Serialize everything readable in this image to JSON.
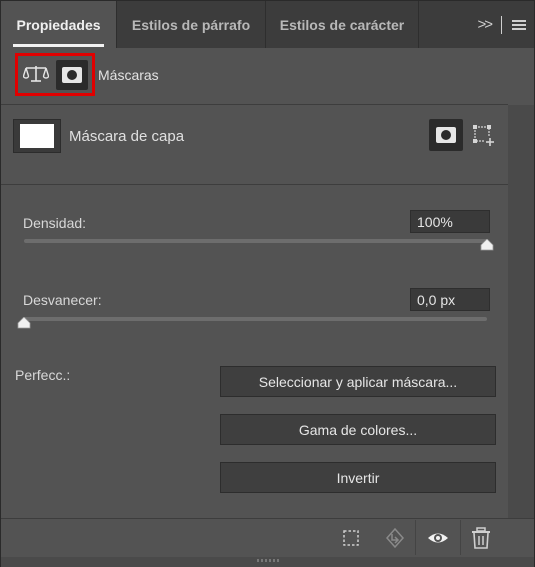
{
  "tabs": [
    {
      "label": "Propiedades",
      "active": true
    },
    {
      "label": "Estilos de párrafo",
      "active": false
    },
    {
      "label": "Estilos de carácter",
      "active": false
    }
  ],
  "tab_tools": {
    "overflow": ">>",
    "menu_icon": "hamburger-menu-icon"
  },
  "section": {
    "title": "Máscaras",
    "icons": [
      "scale-icon",
      "pixel-mask-icon"
    ],
    "highlight_color": "#e00000"
  },
  "layer": {
    "label": "Máscara de capa",
    "icons": [
      "add-pixel-mask-icon",
      "add-vector-mask-icon"
    ]
  },
  "density": {
    "label": "Densidad:",
    "value": "100%",
    "fraction": 1.0
  },
  "feather": {
    "label": "Desvanecer:",
    "value": "0,0 px",
    "fraction": 0.0
  },
  "refine": {
    "label": "Perfecc.:",
    "buttons": [
      "Seleccionar y aplicar máscara...",
      "Gama de colores...",
      "Invertir"
    ]
  },
  "bottom_icons": [
    "load-selection-icon",
    "apply-mask-icon",
    "visibility-eye-icon",
    "trash-icon"
  ],
  "colors": {
    "panel": "#535353",
    "tabbar": "#3c3c3c",
    "input_bg": "#3a3a3a",
    "button_bg": "#3f3f3f"
  }
}
